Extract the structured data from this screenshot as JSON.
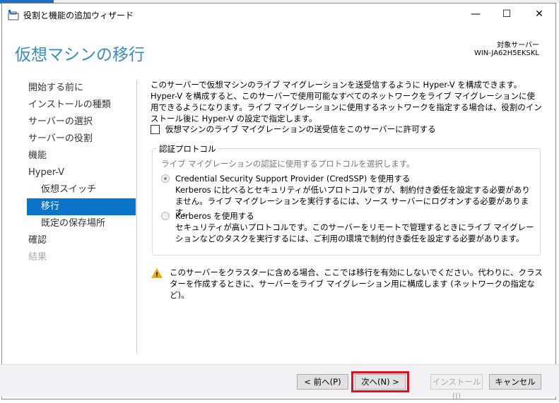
{
  "window": {
    "title": "役割と機能の追加ウィザード",
    "minimize": "—",
    "maximize": "☐",
    "close": "✕"
  },
  "header": {
    "title": "仮想マシンの移行",
    "target_label": "対象サーバー",
    "target_name": "WIN-JA62H5EKSKL"
  },
  "sidebar": {
    "items": [
      {
        "label": "開始する前に",
        "state": "normal"
      },
      {
        "label": "インストールの種類",
        "state": "normal"
      },
      {
        "label": "サーバーの選択",
        "state": "normal"
      },
      {
        "label": "サーバーの役割",
        "state": "normal"
      },
      {
        "label": "機能",
        "state": "normal"
      },
      {
        "label": "Hyper-V",
        "state": "normal"
      },
      {
        "label": "仮想スイッチ",
        "state": "sub"
      },
      {
        "label": "移行",
        "state": "active"
      },
      {
        "label": "既定の保存場所",
        "state": "sub"
      },
      {
        "label": "確認",
        "state": "normal"
      },
      {
        "label": "結果",
        "state": "disabled"
      }
    ]
  },
  "content": {
    "intro": "このサーバーで仮想マシンのライブ マイグレーションを送受信するように Hyper-V を構成できます。Hyper-V を構成すると、このサーバーで使用可能なすべてのネットワークをライブ マイグレーションに使用できるようになります。ライブ マイグレーションに使用するネットワークを指定する場合は、役割のインストール後に Hyper-V の設定で指定します。",
    "checkbox_label": "仮想マシンのライブ マイグレーションの送受信をこのサーバーに許可する",
    "checkbox_checked": false,
    "group_title": "認証プロトコル",
    "group_desc": "ライブ マイグレーションの認証に使用するプロトコルを選択します。",
    "options": [
      {
        "label": "Credential Security Support Provider (CredSSP) を使用する",
        "desc": "Kerberos に比べるとセキュリティが低いプロトコルですが、制約付き委任を設定する必要がありません。ライブ マイグレーションを実行するには、ソース サーバーにログオンする必要があります。",
        "selected": true
      },
      {
        "label": "Kerberos を使用する",
        "desc": "セキュリティが高いプロトコルです。このサーバーをリモートで管理するときにライブ マイグレーションなどのタスクを実行するには、ご利用の環境で制約付き委任を設定する必要があります。",
        "selected": false
      }
    ],
    "warning": "このサーバーをクラスターに含める場合、ここでは移行を有効にしないでください。代わりに、クラスターを作成するときに、サーバーをライブ マイグレーション用に構成します (ネットワークの指定など)。"
  },
  "footer": {
    "prev": "< 前へ(P)",
    "next": "次へ(N) >",
    "install": "インストール(I)",
    "cancel": "キャンセル"
  }
}
